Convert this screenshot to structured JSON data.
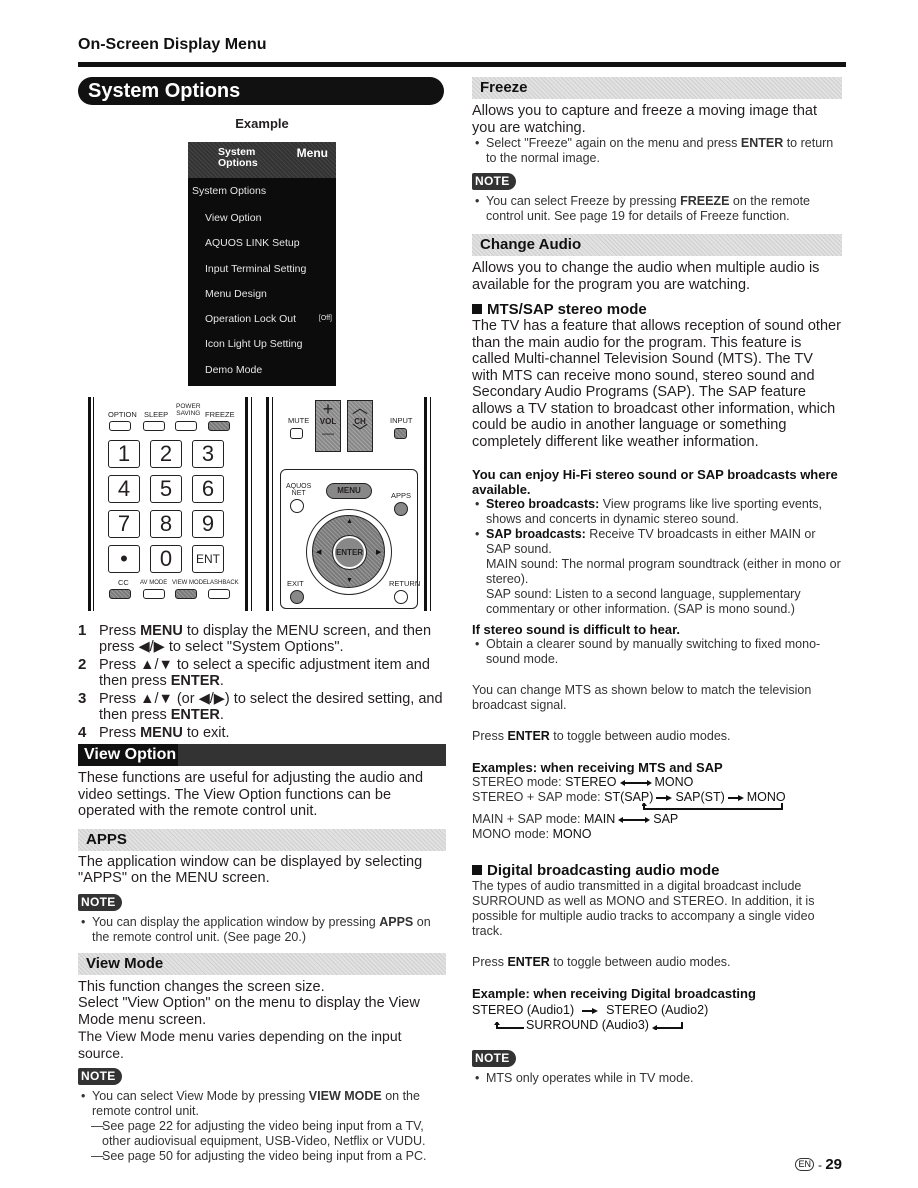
{
  "page": {
    "section_header": "On-Screen Display Menu",
    "page_lang": "EN",
    "page_number": "29"
  },
  "system_options": {
    "title": "System Options",
    "example_label": "Example",
    "osd": {
      "category": "System\nOptions",
      "category_line1": "System",
      "category_line2": "Options",
      "menu_label": "Menu",
      "heading": "System Options",
      "items": [
        {
          "label": "View Option",
          "value": ""
        },
        {
          "label": "AQUOS LINK Setup",
          "value": ""
        },
        {
          "label": "Input Terminal Setting",
          "value": ""
        },
        {
          "label": "Menu Design",
          "value": ""
        },
        {
          "label": "Operation Lock Out",
          "value": "[Off]"
        },
        {
          "label": "Icon Light Up Setting",
          "value": ""
        },
        {
          "label": "Demo Mode",
          "value": ""
        }
      ]
    },
    "remote": {
      "top_buttons": [
        "OPTION",
        "SLEEP",
        "POWER SAVING",
        "FREEZE"
      ],
      "power_saving_line1": "POWER",
      "power_saving_line2": "SAVING",
      "number_keys": [
        "1",
        "2",
        "3",
        "4",
        "5",
        "6",
        "7",
        "8",
        "9",
        "•",
        "0",
        "ENT"
      ],
      "bottom_buttons": [
        "CC",
        "AV MODE",
        "VIEW MODE",
        "FLASHBACK"
      ],
      "mute": "MUTE",
      "vol": "VOL",
      "vol_plus": "+",
      "vol_minus": "—",
      "ch": "CH",
      "ch_up": "⌃",
      "ch_down": "⌄",
      "input": "INPUT",
      "aquos_net_line1": "AQUOS",
      "aquos_net_line2": "NET",
      "menu": "MENU",
      "apps": "APPS",
      "enter": "ENTER",
      "exit": "EXIT",
      "return": "RETURN"
    },
    "steps": [
      {
        "num": "1",
        "parts": [
          [
            "Press ",
            false
          ],
          [
            "MENU",
            true
          ],
          [
            " to display the MENU screen, and then press ◀/▶ to select \"System Options\".",
            false
          ]
        ]
      },
      {
        "num": "2",
        "parts": [
          [
            "Press ▲/▼ to select a specific adjustment item and then press ",
            false
          ],
          [
            "ENTER",
            true
          ],
          [
            ".",
            false
          ]
        ]
      },
      {
        "num": "3",
        "parts": [
          [
            "Press ▲/▼ (or ◀/▶) to select the desired setting, and then press ",
            false
          ],
          [
            "ENTER",
            true
          ],
          [
            ".",
            false
          ]
        ]
      },
      {
        "num": "4",
        "parts": [
          [
            "Press ",
            false
          ],
          [
            "MENU",
            true
          ],
          [
            " to exit.",
            false
          ]
        ]
      }
    ]
  },
  "view_option": {
    "title": "View Option",
    "description": "These functions are useful for adjusting the audio and video settings. The View Option functions can be operated with the remote control unit."
  },
  "apps": {
    "title": "APPS",
    "description": "The application window can be displayed by selecting \"APPS\" on the MENU screen.",
    "note_label": "NOTE",
    "note_pre": "You can display the application window by pressing ",
    "note_bold": "APPS",
    "note_post": " on the remote control unit. (See page 20.)"
  },
  "view_mode": {
    "title": "View Mode",
    "line1": "This function changes the screen size.",
    "line2": "Select \"View Option\" on the menu to display the View Mode menu screen.",
    "line3": "The View Mode menu varies depending on the input source.",
    "note_label": "NOTE",
    "note_pre": "You can select View Mode by pressing ",
    "note_bold": "VIEW MODE",
    "note_post": " on the remote control unit.",
    "sub1": "See page 22 for adjusting the video being input from a TV, other audiovisual equipment, USB-Video, Netflix or VUDU.",
    "sub2": "See page 50 for adjusting the video being input from a PC."
  },
  "freeze": {
    "title": "Freeze",
    "description": "Allows you to capture and freeze a moving image that you are watching.",
    "bullet_pre": "Select \"Freeze\" again on the menu and press ",
    "bullet_bold": "ENTER",
    "bullet_post": " to return to the normal image.",
    "note_label": "NOTE",
    "note_pre": "You can select Freeze by pressing ",
    "note_bold": "FREEZE",
    "note_post": " on the remote control unit. See page 19 for details of Freeze function."
  },
  "change_audio": {
    "title": "Change Audio",
    "description": "Allows you to change the audio when multiple audio is available for the program you are watching.",
    "mts": {
      "heading": "MTS/SAP stereo mode",
      "body": "The TV has a feature that allows reception of sound other than the main audio for the program. This feature is called Multi-channel Television Sound (MTS). The TV with MTS can receive mono sound, stereo sound and Secondary Audio Programs (SAP). The SAP feature allows a TV station to broadcast other information, which could be audio in another language or something completely different like weather information.",
      "hifi_heading": "You can enjoy Hi-Fi stereo sound or SAP broadcasts where available.",
      "stereo_bold": "Stereo broadcasts:",
      "stereo_text": " View programs like live sporting events, shows and concerts in dynamic stereo sound.",
      "sap_bold": "SAP broadcasts:",
      "sap_text": " Receive TV broadcasts in either MAIN or SAP sound.",
      "main_sound": "MAIN sound: The normal program soundtrack (either in mono or stereo).",
      "sap_sound": "SAP sound: Listen to a second language, supplementary commentary or other information. (SAP is mono sound.)",
      "difficult_heading": "If stereo sound is difficult to hear.",
      "difficult_bullet": "Obtain a clearer sound by manually switching to fixed mono-sound mode.",
      "change_text": "You can change MTS as shown below to match the television broadcast signal.",
      "press_pre": "Press ",
      "press_bold": "ENTER",
      "press_post": " to toggle between audio modes.",
      "examples_heading": "Examples: when receiving MTS and SAP",
      "ex_stereo_label": "STEREO mode: ",
      "ex_stereo_a": "STEREO",
      "ex_stereo_b": "MONO",
      "ex_stsap_label": "STEREO + SAP mode: ",
      "ex_stsap_a": "ST(SAP)",
      "ex_stsap_b": "SAP(ST)",
      "ex_stsap_c": "MONO",
      "ex_mainsap_label": "MAIN + SAP mode: ",
      "ex_mainsap_a": "MAIN",
      "ex_mainsap_b": "SAP",
      "ex_mono_label": "MONO mode: ",
      "ex_mono_a": "MONO"
    },
    "digital": {
      "heading": "Digital broadcasting audio mode",
      "body": "The types of audio transmitted in a digital broadcast include SURROUND as well as MONO and STEREO. In addition, it is possible for multiple audio tracks to accompany a single video track.",
      "press_pre": "Press ",
      "press_bold": "ENTER",
      "press_post": " to toggle between audio modes.",
      "example_heading": "Example: when receiving Digital broadcasting",
      "flow_a": "STEREO (Audio1)",
      "flow_b": "STEREO (Audio2)",
      "flow_c": "SURROUND (Audio3)",
      "note_label": "NOTE",
      "note_text": "MTS only operates while in TV mode."
    }
  }
}
